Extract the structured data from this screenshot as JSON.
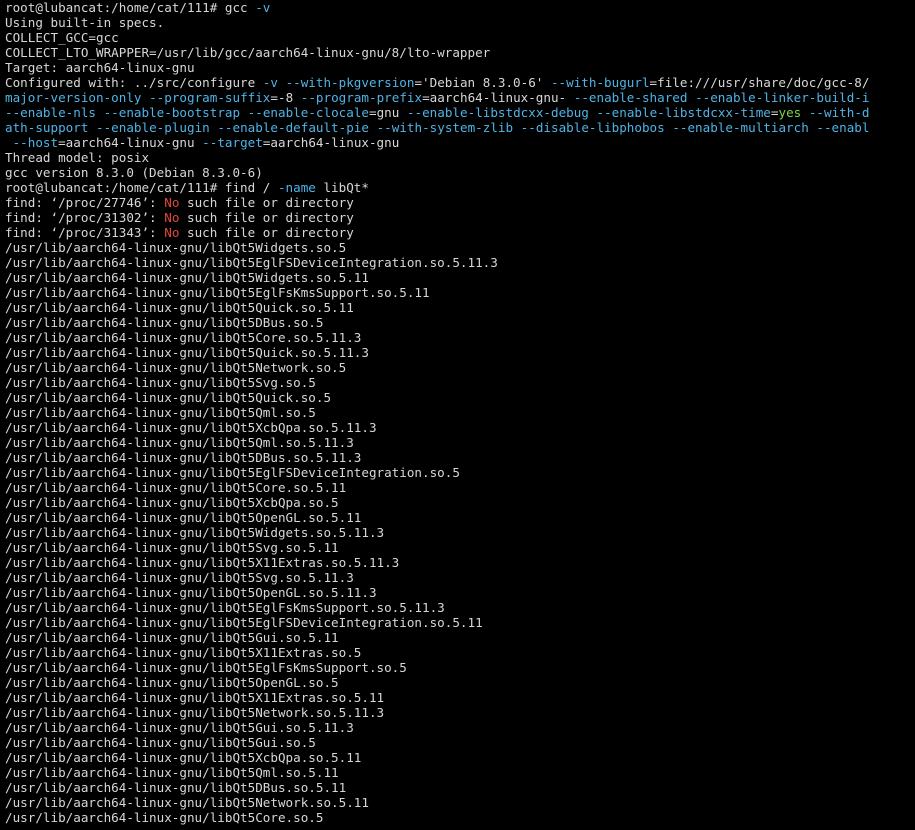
{
  "colors": {
    "background": "#000000",
    "text": "#d7d7d7",
    "flag": "#4fb3e6",
    "error": "#e0463e",
    "yes": "#7fd44a"
  },
  "terminal": {
    "lines": [
      [
        {
          "t": "root@lubancat:/home/cat/111# gcc ",
          "c": "default"
        },
        {
          "t": "-v",
          "c": "flag"
        }
      ],
      [
        {
          "t": "Using built-in specs.",
          "c": "default"
        }
      ],
      [
        {
          "t": "COLLECT_GCC=gcc",
          "c": "default"
        }
      ],
      [
        {
          "t": "COLLECT_LTO_WRAPPER=/usr/lib/gcc/aarch64-linux-gnu/8/lto-wrapper",
          "c": "default"
        }
      ],
      [
        {
          "t": "Target: aarch64-linux-gnu",
          "c": "default"
        }
      ],
      [
        {
          "t": "Configured with: ../src/configure ",
          "c": "default"
        },
        {
          "t": "-v",
          "c": "flag"
        },
        {
          "t": " ",
          "c": "default"
        },
        {
          "t": "--with-pkgversion",
          "c": "flag"
        },
        {
          "t": "='Debian 8.3.0-6' ",
          "c": "default"
        },
        {
          "t": "--with-bugurl",
          "c": "flag"
        },
        {
          "t": "=file:///usr/share/doc/gcc-8/",
          "c": "default"
        }
      ],
      [
        {
          "t": "major-version-only",
          "c": "flag"
        },
        {
          "t": " ",
          "c": "default"
        },
        {
          "t": "--program-suffix",
          "c": "flag"
        },
        {
          "t": "=-8 ",
          "c": "default"
        },
        {
          "t": "--program-prefix",
          "c": "flag"
        },
        {
          "t": "=aarch64-linux-gnu- ",
          "c": "default"
        },
        {
          "t": "--enable-shared",
          "c": "flag"
        },
        {
          "t": " ",
          "c": "default"
        },
        {
          "t": "--enable-linker-build-i",
          "c": "flag"
        }
      ],
      [
        {
          "t": "--enable-nls",
          "c": "flag"
        },
        {
          "t": " ",
          "c": "default"
        },
        {
          "t": "--enable-bootstrap",
          "c": "flag"
        },
        {
          "t": " ",
          "c": "default"
        },
        {
          "t": "--enable-clocale",
          "c": "flag"
        },
        {
          "t": "=gnu ",
          "c": "default"
        },
        {
          "t": "--enable-libstdcxx-debug",
          "c": "flag"
        },
        {
          "t": " ",
          "c": "default"
        },
        {
          "t": "--enable-libstdcxx-time",
          "c": "flag"
        },
        {
          "t": "=",
          "c": "default"
        },
        {
          "t": "yes",
          "c": "green"
        },
        {
          "t": " ",
          "c": "default"
        },
        {
          "t": "--with-d",
          "c": "flag"
        }
      ],
      [
        {
          "t": "ath-support",
          "c": "flag"
        },
        {
          "t": " ",
          "c": "default"
        },
        {
          "t": "--enable-plugin",
          "c": "flag"
        },
        {
          "t": " ",
          "c": "default"
        },
        {
          "t": "--enable-default-pie",
          "c": "flag"
        },
        {
          "t": " ",
          "c": "default"
        },
        {
          "t": "--with-system-zlib",
          "c": "flag"
        },
        {
          "t": " ",
          "c": "default"
        },
        {
          "t": "--disable-libphobos",
          "c": "flag"
        },
        {
          "t": " ",
          "c": "default"
        },
        {
          "t": "--enable-multiarch",
          "c": "flag"
        },
        {
          "t": " ",
          "c": "default"
        },
        {
          "t": "--enabl",
          "c": "flag"
        }
      ],
      [
        {
          "t": " ",
          "c": "default"
        },
        {
          "t": "--host",
          "c": "flag"
        },
        {
          "t": "=aarch64-linux-gnu ",
          "c": "default"
        },
        {
          "t": "--target",
          "c": "flag"
        },
        {
          "t": "=aarch64-linux-gnu",
          "c": "default"
        }
      ],
      [
        {
          "t": "Thread model: posix",
          "c": "default"
        }
      ],
      [
        {
          "t": "gcc version 8.3.0 (Debian 8.3.0-6)",
          "c": "default"
        }
      ],
      [
        {
          "t": "root@lubancat:/home/cat/111# find / ",
          "c": "default"
        },
        {
          "t": "-name",
          "c": "flag"
        },
        {
          "t": " libQt*",
          "c": "default"
        }
      ],
      [
        {
          "t": "find: ‘/proc/27746’: ",
          "c": "default"
        },
        {
          "t": "No",
          "c": "red"
        },
        {
          "t": " such file or directory",
          "c": "default"
        }
      ],
      [
        {
          "t": "find: ‘/proc/31302’: ",
          "c": "default"
        },
        {
          "t": "No",
          "c": "red"
        },
        {
          "t": " such file or directory",
          "c": "default"
        }
      ],
      [
        {
          "t": "find: ‘/proc/31343’: ",
          "c": "default"
        },
        {
          "t": "No",
          "c": "red"
        },
        {
          "t": " such file or directory",
          "c": "default"
        }
      ],
      [
        {
          "t": "/usr/lib/aarch64-linux-gnu/libQt5Widgets.so.5",
          "c": "default"
        }
      ],
      [
        {
          "t": "/usr/lib/aarch64-linux-gnu/libQt5EglFSDeviceIntegration.so.5.11.3",
          "c": "default"
        }
      ],
      [
        {
          "t": "/usr/lib/aarch64-linux-gnu/libQt5Widgets.so.5.11",
          "c": "default"
        }
      ],
      [
        {
          "t": "/usr/lib/aarch64-linux-gnu/libQt5EglFsKmsSupport.so.5.11",
          "c": "default"
        }
      ],
      [
        {
          "t": "/usr/lib/aarch64-linux-gnu/libQt5Quick.so.5.11",
          "c": "default"
        }
      ],
      [
        {
          "t": "/usr/lib/aarch64-linux-gnu/libQt5DBus.so.5",
          "c": "default"
        }
      ],
      [
        {
          "t": "/usr/lib/aarch64-linux-gnu/libQt5Core.so.5.11.3",
          "c": "default"
        }
      ],
      [
        {
          "t": "/usr/lib/aarch64-linux-gnu/libQt5Quick.so.5.11.3",
          "c": "default"
        }
      ],
      [
        {
          "t": "/usr/lib/aarch64-linux-gnu/libQt5Network.so.5",
          "c": "default"
        }
      ],
      [
        {
          "t": "/usr/lib/aarch64-linux-gnu/libQt5Svg.so.5",
          "c": "default"
        }
      ],
      [
        {
          "t": "/usr/lib/aarch64-linux-gnu/libQt5Quick.so.5",
          "c": "default"
        }
      ],
      [
        {
          "t": "/usr/lib/aarch64-linux-gnu/libQt5Qml.so.5",
          "c": "default"
        }
      ],
      [
        {
          "t": "/usr/lib/aarch64-linux-gnu/libQt5XcbQpa.so.5.11.3",
          "c": "default"
        }
      ],
      [
        {
          "t": "/usr/lib/aarch64-linux-gnu/libQt5Qml.so.5.11.3",
          "c": "default"
        }
      ],
      [
        {
          "t": "/usr/lib/aarch64-linux-gnu/libQt5DBus.so.5.11.3",
          "c": "default"
        }
      ],
      [
        {
          "t": "/usr/lib/aarch64-linux-gnu/libQt5EglFSDeviceIntegration.so.5",
          "c": "default"
        }
      ],
      [
        {
          "t": "/usr/lib/aarch64-linux-gnu/libQt5Core.so.5.11",
          "c": "default"
        }
      ],
      [
        {
          "t": "/usr/lib/aarch64-linux-gnu/libQt5XcbQpa.so.5",
          "c": "default"
        }
      ],
      [
        {
          "t": "/usr/lib/aarch64-linux-gnu/libQt5OpenGL.so.5.11",
          "c": "default"
        }
      ],
      [
        {
          "t": "/usr/lib/aarch64-linux-gnu/libQt5Widgets.so.5.11.3",
          "c": "default"
        }
      ],
      [
        {
          "t": "/usr/lib/aarch64-linux-gnu/libQt5Svg.so.5.11",
          "c": "default"
        }
      ],
      [
        {
          "t": "/usr/lib/aarch64-linux-gnu/libQt5X11Extras.so.5.11.3",
          "c": "default"
        }
      ],
      [
        {
          "t": "/usr/lib/aarch64-linux-gnu/libQt5Svg.so.5.11.3",
          "c": "default"
        }
      ],
      [
        {
          "t": "/usr/lib/aarch64-linux-gnu/libQt5OpenGL.so.5.11.3",
          "c": "default"
        }
      ],
      [
        {
          "t": "/usr/lib/aarch64-linux-gnu/libQt5EglFsKmsSupport.so.5.11.3",
          "c": "default"
        }
      ],
      [
        {
          "t": "/usr/lib/aarch64-linux-gnu/libQt5EglFSDeviceIntegration.so.5.11",
          "c": "default"
        }
      ],
      [
        {
          "t": "/usr/lib/aarch64-linux-gnu/libQt5Gui.so.5.11",
          "c": "default"
        }
      ],
      [
        {
          "t": "/usr/lib/aarch64-linux-gnu/libQt5X11Extras.so.5",
          "c": "default"
        }
      ],
      [
        {
          "t": "/usr/lib/aarch64-linux-gnu/libQt5EglFsKmsSupport.so.5",
          "c": "default"
        }
      ],
      [
        {
          "t": "/usr/lib/aarch64-linux-gnu/libQt5OpenGL.so.5",
          "c": "default"
        }
      ],
      [
        {
          "t": "/usr/lib/aarch64-linux-gnu/libQt5X11Extras.so.5.11",
          "c": "default"
        }
      ],
      [
        {
          "t": "/usr/lib/aarch64-linux-gnu/libQt5Network.so.5.11.3",
          "c": "default"
        }
      ],
      [
        {
          "t": "/usr/lib/aarch64-linux-gnu/libQt5Gui.so.5.11.3",
          "c": "default"
        }
      ],
      [
        {
          "t": "/usr/lib/aarch64-linux-gnu/libQt5Gui.so.5",
          "c": "default"
        }
      ],
      [
        {
          "t": "/usr/lib/aarch64-linux-gnu/libQt5XcbQpa.so.5.11",
          "c": "default"
        }
      ],
      [
        {
          "t": "/usr/lib/aarch64-linux-gnu/libQt5Qml.so.5.11",
          "c": "default"
        }
      ],
      [
        {
          "t": "/usr/lib/aarch64-linux-gnu/libQt5DBus.so.5.11",
          "c": "default"
        }
      ],
      [
        {
          "t": "/usr/lib/aarch64-linux-gnu/libQt5Network.so.5.11",
          "c": "default"
        }
      ],
      [
        {
          "t": "/usr/lib/aarch64-linux-gnu/libQt5Core.so.5",
          "c": "default"
        }
      ]
    ]
  }
}
